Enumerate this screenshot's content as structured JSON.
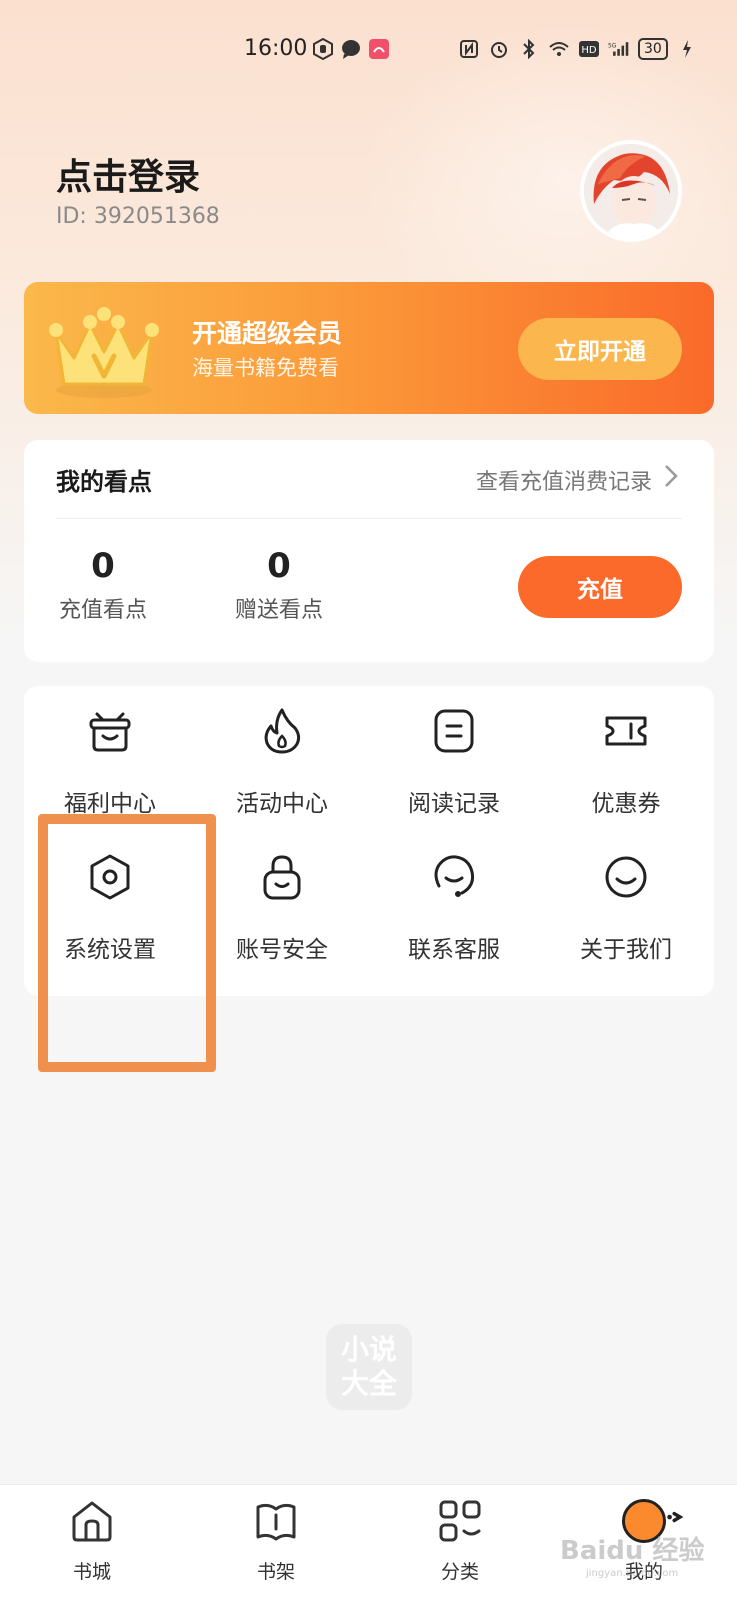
{
  "status_bar": {
    "time": "16:00",
    "battery": "30"
  },
  "profile": {
    "login_label": "点击登录",
    "user_id": "ID: 392051368"
  },
  "vip_banner": {
    "title": "开通超级会员",
    "subtitle": "海量书籍免费看",
    "button_label": "立即开通",
    "crown_letter": "V"
  },
  "points": {
    "title": "我的看点",
    "history_link": "查看充值消费记录",
    "recharged_value": "0",
    "recharged_label": "充值看点",
    "gifted_value": "0",
    "gifted_label": "赠送看点",
    "recharge_button": "充值"
  },
  "menu": {
    "items": [
      {
        "label": "福利中心",
        "icon": "gift-box-icon"
      },
      {
        "label": "活动中心",
        "icon": "flame-icon"
      },
      {
        "label": "阅读记录",
        "icon": "reading-record-icon"
      },
      {
        "label": "优惠券",
        "icon": "coupon-icon"
      },
      {
        "label": "系统设置",
        "icon": "settings-icon"
      },
      {
        "label": "账号安全",
        "icon": "lock-icon"
      },
      {
        "label": "联系客服",
        "icon": "customer-service-icon"
      },
      {
        "label": "关于我们",
        "icon": "smiley-icon"
      }
    ]
  },
  "app_logo": {
    "line1": "小说",
    "line2": "大全"
  },
  "bottom_nav": {
    "items": [
      {
        "label": "书城",
        "icon": "home-icon"
      },
      {
        "label": "书架",
        "icon": "bookshelf-icon"
      },
      {
        "label": "分类",
        "icon": "category-icon"
      },
      {
        "label": "我的",
        "icon": "profile-icon"
      }
    ],
    "active_index": 3
  },
  "watermark": {
    "brand": "Baidu 经验",
    "url": "jingyan.baidu.com"
  },
  "colors": {
    "accent": "#fb6a2b",
    "highlight_box": "#f0904f",
    "vip_gold": "#fbb64d"
  }
}
